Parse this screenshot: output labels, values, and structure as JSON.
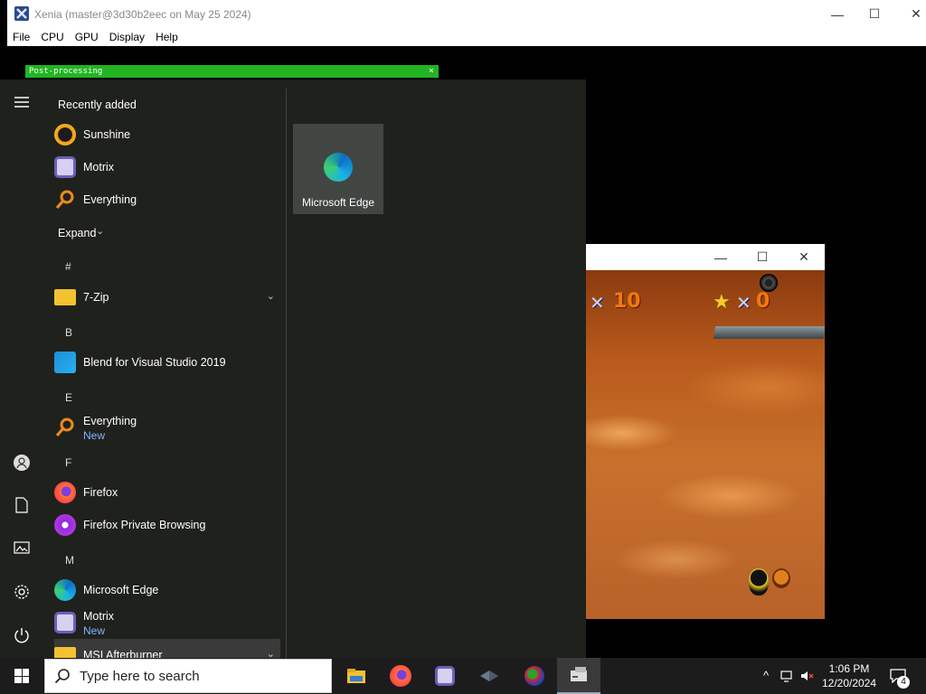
{
  "xenia": {
    "title": "Xenia (master@3d30b2eec on May 25 2024)",
    "menu": [
      "File",
      "CPU",
      "GPU",
      "Display",
      "Help"
    ],
    "postprocessing_label": "Post-processing",
    "postprocessing_close": "×"
  },
  "game": {
    "hud_left_x": "✕",
    "hud_left_count": "10",
    "hud_right_x": "✕",
    "hud_right_count": "0",
    "star_glyph": "★"
  },
  "start_menu": {
    "recently_added_label": "Recently added",
    "expand_label": "Expand",
    "recent": [
      {
        "label": "Sunshine"
      },
      {
        "label": "Motrix"
      },
      {
        "label": "Everything"
      }
    ],
    "letters": [
      "#",
      "B",
      "E",
      "F",
      "M"
    ],
    "apps": {
      "zip": "7-Zip",
      "blend": "Blend for Visual Studio 2019",
      "everything": "Everything",
      "everything_sub": "New",
      "firefox": "Firefox",
      "firefox_private": "Firefox Private Browsing",
      "edge": "Microsoft Edge",
      "motrix": "Motrix",
      "motrix_sub": "New",
      "msi": "MSI Afterburner"
    },
    "tile": {
      "label": "Microsoft Edge"
    }
  },
  "taskbar": {
    "search_placeholder": "Type here to search",
    "time": "1:06 PM",
    "date": "12/20/2024",
    "notification_count": "4"
  },
  "colors": {
    "postproc": "#22b422",
    "accent": "#7fb4ff",
    "taskbar": "#1c1c1c"
  }
}
